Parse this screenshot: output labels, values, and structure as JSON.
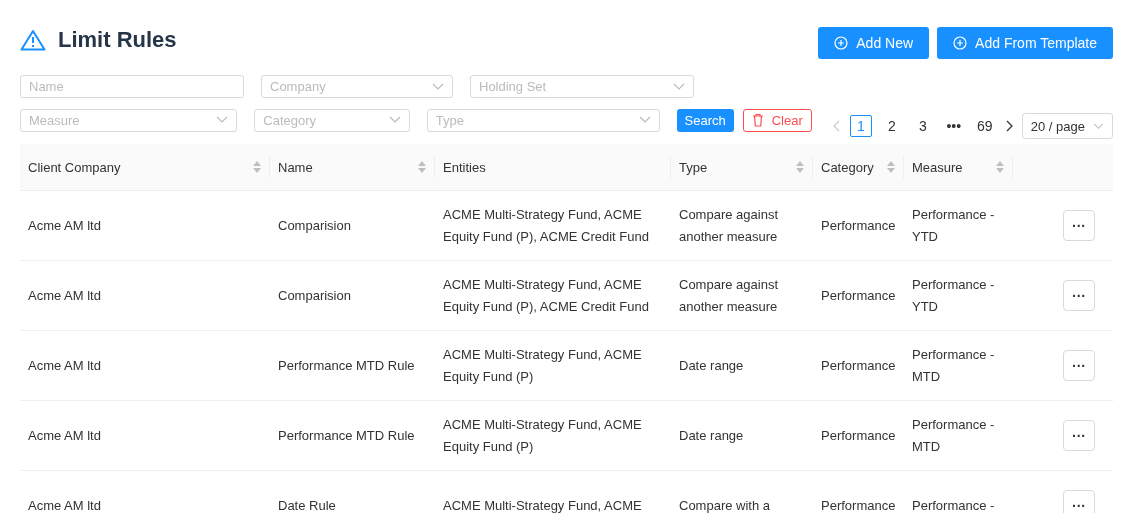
{
  "header": {
    "title": "Limit Rules",
    "buttons": [
      "Add New",
      "Add From Template"
    ]
  },
  "filters": {
    "row_1": [
      {
        "kind": "input",
        "placeholder": "Name"
      },
      {
        "kind": "select",
        "placeholder": "Company"
      },
      {
        "kind": "select",
        "placeholder": "Holding Set"
      }
    ],
    "row_2": [
      {
        "kind": "select",
        "placeholder": "Measure"
      },
      {
        "kind": "select",
        "placeholder": "Category"
      },
      {
        "kind": "select",
        "placeholder": "Type"
      }
    ],
    "search_button": "Search",
    "clear_button": "Clear"
  },
  "pagination": {
    "prev_disabled": true,
    "pages": [
      {
        "label": "1",
        "selected": true
      },
      {
        "label": "2",
        "selected": false
      },
      {
        "label": "3",
        "selected": false
      },
      {
        "label": "•••",
        "selected": false
      },
      {
        "label": "69",
        "selected": false
      }
    ],
    "page_size": "20 / page"
  },
  "table": {
    "columns": [
      {
        "label": "Client Company",
        "sortable": true
      },
      {
        "label": "Name",
        "sortable": true
      },
      {
        "label": "Entities",
        "sortable": false
      },
      {
        "label": "Type",
        "sortable": true
      },
      {
        "label": "Category",
        "sortable": true
      },
      {
        "label": "Measure",
        "sortable": true
      }
    ],
    "row_action": "···",
    "rows": [
      {
        "cells": [
          "Acme AM ltd",
          "Comparision",
          "ACME Multi-Strategy Fund, ACME Equity Fund (P), ACME Credit Fund",
          "Compare against another measure",
          "Performance",
          "Performance - YTD"
        ]
      },
      {
        "cells": [
          "Acme AM ltd",
          "Comparision",
          "ACME Multi-Strategy Fund, ACME Equity Fund (P), ACME Credit Fund",
          "Compare against another measure",
          "Performance",
          "Performance - YTD"
        ]
      },
      {
        "cells": [
          "Acme AM ltd",
          "Performance MTD Rule",
          "ACME Multi-Strategy Fund, ACME Equity Fund (P)",
          "Date range",
          "Performance",
          "Performance - MTD"
        ]
      },
      {
        "cells": [
          "Acme AM ltd",
          "Performance MTD Rule",
          "ACME Multi-Strategy Fund, ACME Equity Fund (P)",
          "Date range",
          "Performance",
          "Performance - MTD"
        ]
      },
      {
        "cells": [
          "Acme AM ltd",
          "Date Rule",
          "ACME Multi-Strategy Fund, ACME",
          "Compare with a",
          "Performance",
          "Performance -"
        ]
      }
    ]
  }
}
